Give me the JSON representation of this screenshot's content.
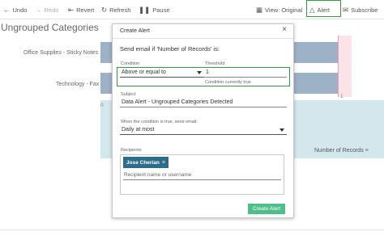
{
  "toolbar": {
    "undo": "Undo",
    "redo": "Redo",
    "revert": "Revert",
    "refresh": "Refresh",
    "pause": "Pause",
    "view": "View: Original",
    "alert": "Alert",
    "subscribe": "Subscribe",
    "icons": {
      "undo": "undo-arrow-icon",
      "redo": "redo-arrow-icon",
      "revert": "revert-icon",
      "refresh": "refresh-icon",
      "pause": "pause-icon",
      "view": "view-icon",
      "alert": "bell-icon",
      "subscribe": "email-icon"
    }
  },
  "sheet": {
    "title": "Ungrouped Categories",
    "rows": [
      "Office Supplies - Sticky Notes",
      "Technology - Fax"
    ],
    "axis_ticks": [
      "0",
      "1"
    ],
    "axis_title": "Number of Records",
    "bar_color": "#9db1c7",
    "reference_line_color": "#f29ab0"
  },
  "dialog": {
    "title": "Create Alert",
    "heading": "Send email if 'Number of Records' is:",
    "condition_label": "Condition",
    "condition_value": "Above or equal to",
    "threshold_label": "Threshold",
    "threshold_value": "1",
    "threshold_hint": "Condition currently true",
    "subject_label": "Subject",
    "subject_value": "Data Alert - Ungrouped Categories Detected",
    "frequency_label": "When the condition is true, send email:",
    "frequency_value": "Daily at most",
    "recipients_label": "Recipients",
    "recipient_chip": "Jose Cherian",
    "recipient_placeholder": "Recipient name or username",
    "create_button": "Create Alert",
    "accent_color": "#4fbf8a",
    "chip_color": "#2e6d88",
    "highlight_color": "#2e9e3e"
  }
}
